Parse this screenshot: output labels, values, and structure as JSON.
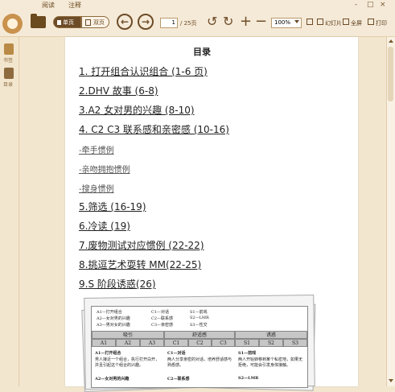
{
  "menu": {
    "read": "阅读",
    "annotate": "注释"
  },
  "window": {
    "minimize": "-",
    "maximize": "□",
    "close": "×"
  },
  "toolbar": {
    "single_page": "单页",
    "double_page": "双页",
    "current_page": "1",
    "total_pages": "/ 25页",
    "zoom": "100%",
    "slideshow": "幻灯片",
    "fullscreen": "全屏",
    "print": "打印"
  },
  "sidebar": {
    "bookmarks": "书签",
    "toc": "目录"
  },
  "doc": {
    "heading": "目录",
    "items": [
      "1. 打开组合认识组合 (1-6 页)",
      "2.DHV 故事 (6-8)",
      "3.A2 女对男的兴趣 (8-10)",
      "4. C2 C3 联系感和亲密感 (10-16)",
      "-牵手惯例",
      "-亲吻拥抱惯例",
      "-搜身惯例",
      "5.筛选 (16-19)",
      "6.冷读 (19)",
      "7.废物测试对应惯例 (22-22)",
      "8.挑逗艺术耍转 MM(22-25)",
      "9.S 阶段诱惑(26)"
    ],
    "table": {
      "legend": [
        "A1—打开组合",
        "C1—对话",
        "S1—前戏",
        "A2—女对男的兴趣",
        "C2—联系感",
        "S2—LMR",
        "A3—男对女的兴趣",
        "C3—亲密感",
        "S3—性交"
      ],
      "groups": [
        "吸引",
        "舒适感",
        "诱惑"
      ],
      "cols": [
        "A1",
        "A2",
        "A3",
        "C1",
        "C2",
        "C3",
        "S1",
        "S2",
        "S3"
      ],
      "row1": [
        "A1—打开组合",
        "男人接近一个组合，执行打开白开，并且引起这个组合的兴趣。",
        "C1—对话",
        "两人分享亲密的对话，培养舒适感与熟悉感。",
        "S1—前戏",
        "两人开始转移到某个私密地，如果无拒绝，可能会引发身体接触。"
      ],
      "row2": [
        "A2—女对男的兴趣",
        "C2—联系感",
        "S2—LMR"
      ]
    }
  }
}
